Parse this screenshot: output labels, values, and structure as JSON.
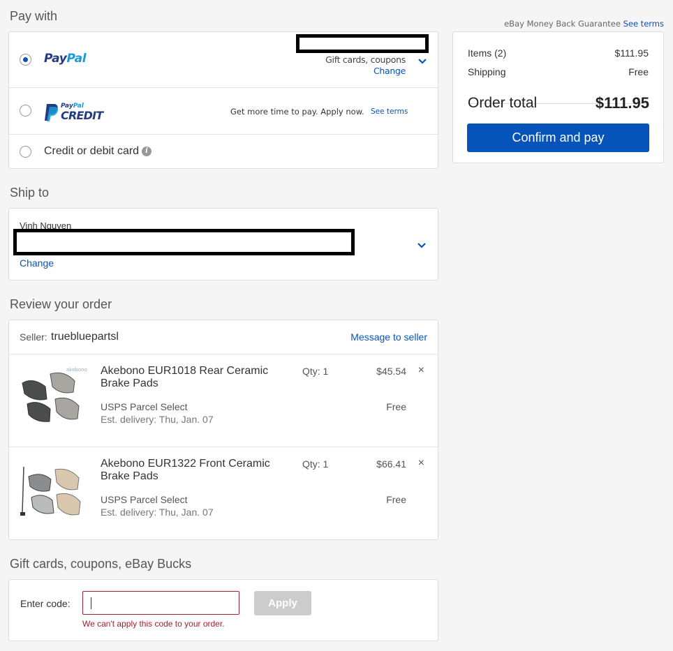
{
  "pay_with": {
    "title": "Pay with",
    "options": [
      {
        "id": "paypal",
        "logo_parts": [
          "Pay",
          "Pal"
        ],
        "selected": true,
        "gift_text": "Gift cards, coupons",
        "change_label": "Change",
        "icon": "chevron-down-icon"
      },
      {
        "id": "paypal-credit",
        "logo_small": [
          "Pay",
          "Pal"
        ],
        "logo_big": "CREDIT",
        "selected": false,
        "promo_text": "Get more time to pay. Apply now.",
        "see_terms_label": "See terms"
      },
      {
        "id": "card",
        "label": "Credit or debit card",
        "selected": false,
        "icon": "info-icon"
      }
    ]
  },
  "ship_to": {
    "title": "Ship to",
    "name": "Vinh Nguyen",
    "change_label": "Change",
    "icon": "chevron-down-icon"
  },
  "review": {
    "title": "Review your order",
    "seller_label": "Seller:",
    "seller_name": "truebluepartsl",
    "message_label": "Message to seller",
    "items": [
      {
        "title": "Akebono EUR1018 Rear Ceramic Brake Pads",
        "qty": "Qty: 1",
        "price": "$45.54",
        "shipping_method": "USPS Parcel Select",
        "delivery": "Est. delivery: Thu, Jan. 07",
        "shipping_cost": "Free",
        "remove_icon": "×"
      },
      {
        "title": "Akebono EUR1322 Front Ceramic Brake Pads",
        "qty": "Qty: 1",
        "price": "$66.41",
        "shipping_method": "USPS Parcel Select",
        "delivery": "Est. delivery: Thu, Jan. 07",
        "shipping_cost": "Free",
        "remove_icon": "×"
      }
    ]
  },
  "gift": {
    "title": "Gift cards, coupons, eBay Bucks",
    "enter_label": "Enter code:",
    "input_value": "",
    "apply_label": "Apply",
    "error": "We can't apply this code to your order."
  },
  "summary": {
    "guarantee_text": "eBay Money Back Guarantee",
    "see_terms_label": "See terms",
    "items_label": "Items (2)",
    "items_value": "$111.95",
    "shipping_label": "Shipping",
    "shipping_value": "Free",
    "total_label": "Order total",
    "total_value": "$111.95",
    "confirm_label": "Confirm and pay"
  },
  "colors": {
    "accent": "#0654ba",
    "error": "#a3212b",
    "paypal_dark": "#253b80",
    "paypal_light": "#179bd7"
  }
}
